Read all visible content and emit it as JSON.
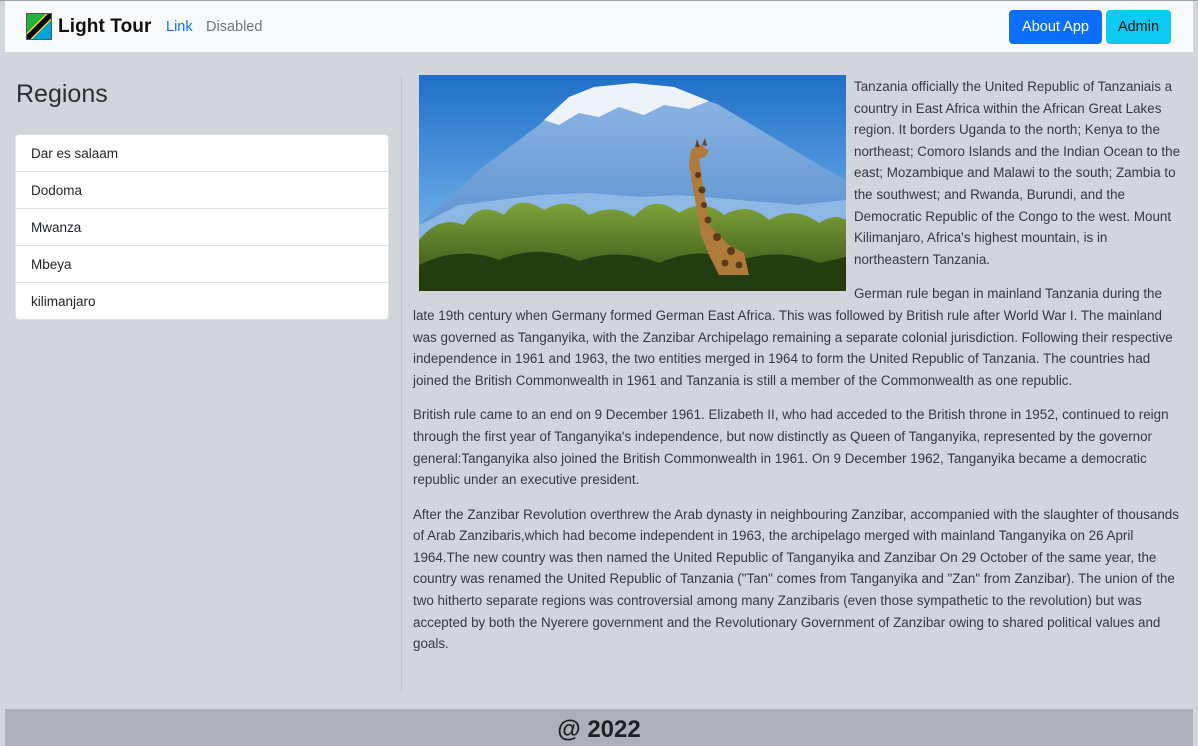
{
  "navbar": {
    "brand": "Light Tour",
    "links": [
      "Link",
      "Disabled"
    ],
    "buttons": {
      "about": "About App",
      "admin": "Admin"
    },
    "colors": {
      "primary": "#0d6efd",
      "info": "#0dcaf0"
    }
  },
  "sidebar": {
    "title": "Regions",
    "regions": [
      "Dar es salaam",
      "Dodoma",
      "Mwanza",
      "Mbeya",
      "kilimanjaro"
    ]
  },
  "main": {
    "image": {
      "icon": "kilimanjaro-giraffe-photo"
    },
    "paragraphs": [
      "Tanzania officially the United Republic of Tanzaniais a country in East Africa within the African Great Lakes region. It borders Uganda to the north; Kenya to the northeast; Comoro Islands and the Indian Ocean to the east; Mozambique and Malawi to the south; Zambia to the southwest; and Rwanda, Burundi, and the Democratic Republic of the Congo to the west. Mount Kilimanjaro, Africa's highest mountain, is in northeastern Tanzania.",
      "German rule began in mainland Tanzania during the late 19th century when Germany formed German East Africa. This was followed by British rule after World War I. The mainland was governed as Tanganyika, with the Zanzibar Archipelago remaining a separate colonial jurisdiction. Following their respective independence in 1961 and 1963, the two entities merged in 1964 to form the United Republic of Tanzania. The countries had joined the British Commonwealth in 1961 and Tanzania is still a member of the Commonwealth as one republic.",
      "British rule came to an end on 9 December 1961. Elizabeth II, who had acceded to the British throne in 1952, continued to reign through the first year of Tanganyika's independence, but now distinctly as Queen of Tanganyika, represented by the governor general:Tanganyika also joined the British Commonwealth in 1961. On 9 December 1962, Tanganyika became a democratic republic under an executive president.",
      "After the Zanzibar Revolution overthrew the Arab dynasty in neighbouring Zanzibar, accompanied with the slaughter of thousands of Arab Zanzibaris,which had become independent in 1963, the archipelago merged with mainland Tanganyika on 26 April 1964.The new country was then named the United Republic of Tanganyika and Zanzibar On 29 October of the same year, the country was renamed the United Republic of Tanzania (\"Tan\" comes from Tanganyika and \"Zan\" from Zanzibar). The union of the two hitherto separate regions was controversial among many Zanzibaris (even those sympathetic to the revolution) but was accepted by both the Nyerere government and the Revolutionary Government of Zanzibar owing to shared political values and goals."
    ]
  },
  "footer": {
    "text": "@ 2022"
  }
}
